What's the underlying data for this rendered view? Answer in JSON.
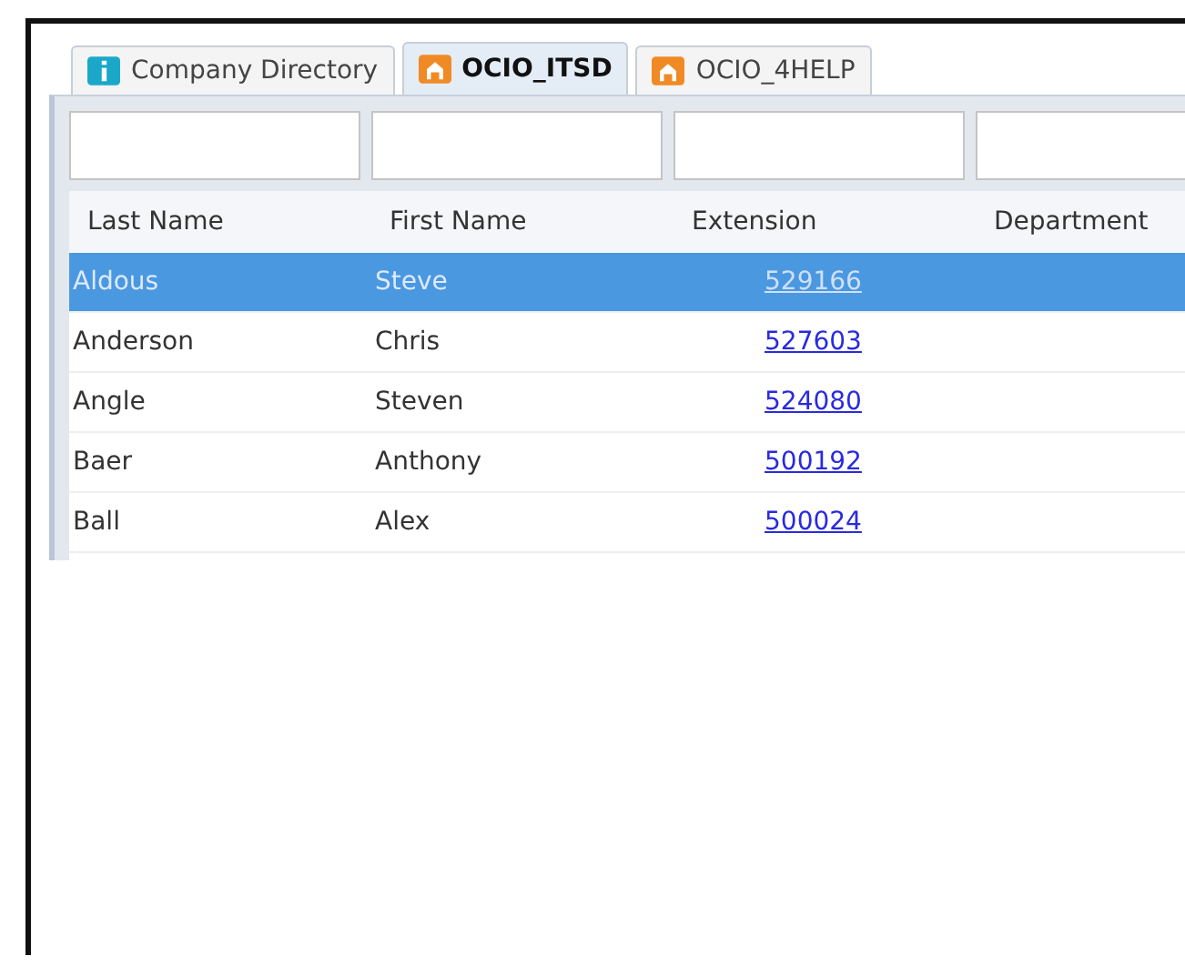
{
  "tabs": [
    {
      "label": "Company Directory",
      "kind": "info",
      "selected": false
    },
    {
      "label": "OCIO_ITSD",
      "kind": "home",
      "selected": true
    },
    {
      "label": "OCIO_4HELP",
      "kind": "home",
      "selected": false
    }
  ],
  "table": {
    "columns": [
      "Last Name",
      "First Name",
      "Extension",
      "Department"
    ],
    "rows": [
      {
        "last_name": "Aldous",
        "first_name": "Steve",
        "extension": "529166",
        "selected": true
      },
      {
        "last_name": "Anderson",
        "first_name": "Chris",
        "extension": "527603",
        "selected": false
      },
      {
        "last_name": "Angle",
        "first_name": "Steven",
        "extension": "524080",
        "selected": false
      },
      {
        "last_name": "Baer",
        "first_name": "Anthony",
        "extension": "500192",
        "selected": false
      },
      {
        "last_name": "Ball",
        "first_name": "Alex",
        "extension": "500024",
        "selected": false
      }
    ]
  }
}
